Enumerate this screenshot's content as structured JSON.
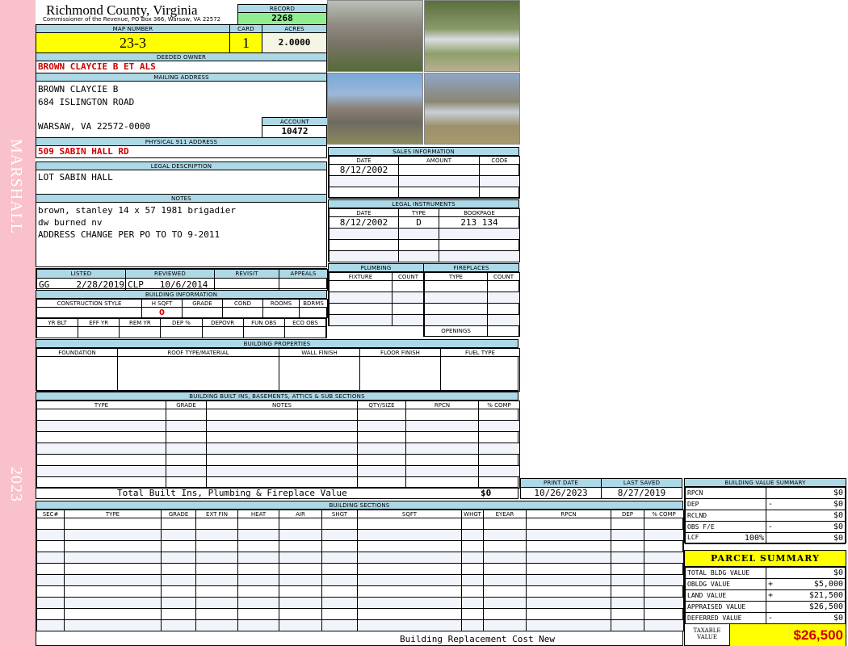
{
  "sidebar": {
    "district": "MARSHALL",
    "year": "2023"
  },
  "header": {
    "title": "Richmond County, Virginia",
    "subtitle": "Commissioner of the Revenue, PO Box 366, Warsaw, VA 22572",
    "record_label": "RECORD",
    "record": "2268"
  },
  "parcel": {
    "map_label": "MAP NUMBER",
    "map": "23-3",
    "card_label": "CARD",
    "card": "1",
    "acres_label": "ACRES",
    "acres": "2.0000"
  },
  "owner": {
    "label": "DEEDED OWNER",
    "name": "BROWN CLAYCIE B ET ALS"
  },
  "mailing": {
    "label": "MAILING ADDRESS",
    "line1": "BROWN CLAYCIE B",
    "line2": "684 ISLINGTON ROAD",
    "line3": "WARSAW, VA 22572-0000",
    "account_label": "ACCOUNT",
    "account": "10472"
  },
  "physical": {
    "label": "PHYSICAL 911 ADDRESS",
    "address": "509 SABIN HALL RD"
  },
  "legal": {
    "label": "LEGAL DESCRIPTION",
    "text": "LOT SABIN HALL"
  },
  "notes": {
    "label": "NOTES",
    "lines": [
      "brown, stanley 14 x 57 1981 brigadier",
      "dw burned nv",
      "ADDRESS CHANGE PER PO TO TO 9-2011"
    ]
  },
  "photos": [
    "house-front",
    "mobile-home",
    "house-side",
    "mobile-home-side"
  ],
  "sales": {
    "label": "SALES INFORMATION",
    "columns": [
      "DATE",
      "AMOUNT",
      "CODE"
    ],
    "rows": [
      [
        "8/12/2002",
        "",
        ""
      ],
      [
        "",
        "",
        ""
      ],
      [
        "",
        "",
        ""
      ]
    ]
  },
  "instruments": {
    "label": "LEGAL INSTRUMENTS",
    "columns": [
      "DATE",
      "TYPE",
      "BOOKPAGE"
    ],
    "rows": [
      [
        "8/12/2002",
        "D",
        "213 134"
      ],
      [
        "",
        "",
        ""
      ],
      [
        "",
        "",
        ""
      ],
      [
        "",
        "",
        ""
      ]
    ]
  },
  "review": {
    "columns": [
      "LISTED",
      "REVIEWED",
      "REVISIT",
      "APPEALS"
    ],
    "values": [
      "GG     2/28/2019",
      "CLP   10/6/2014",
      "",
      ""
    ]
  },
  "building_info": {
    "label": "BUILDING INFORMATION",
    "columns1": [
      "CONSTRUCTION STYLE",
      "H SQFT",
      "GRADE",
      "COND",
      "ROOMS",
      "BDRMS"
    ],
    "values1": [
      "",
      "0",
      "",
      "",
      "",
      ""
    ],
    "columns2": [
      "YR BLT",
      "EFF YR",
      "REM YR",
      "DEP %",
      "DEPOVR",
      "FUN OBS",
      "ECO OBS"
    ]
  },
  "plumbing": {
    "label": "PLUMBING",
    "columns": [
      "FIXTURE",
      "COUNT"
    ]
  },
  "fireplaces": {
    "label": "FIREPLACES",
    "columns": [
      "TYPE",
      "COUNT"
    ],
    "openings_label": "OPENINGS"
  },
  "properties": {
    "label": "BUILDING PROPERTIES",
    "columns": [
      "FOUNDATION",
      "ROOF TYPE/MATERIAL",
      "WALL FINISH",
      "FLOOR FINISH",
      "FUEL TYPE"
    ]
  },
  "builtins": {
    "label": "BUILDING BUILT INS, BASEMENTS, ATTICS & SUB SECTIONS",
    "columns": [
      "TYPE",
      "GRADE",
      "NOTES",
      "QTY/SIZE",
      "RPCN",
      "% COMP"
    ],
    "total_label": "Total Built Ins, Plumbing & Fireplace Value",
    "total": "$0"
  },
  "dates": {
    "print_label": "PRINT DATE",
    "print": "10/26/2023",
    "saved_label": "LAST SAVED",
    "saved": "8/27/2019"
  },
  "sections": {
    "label": "BUILDING SECTIONS",
    "columns": [
      "SEC#",
      "TYPE",
      "GRADE",
      "EXT FIN",
      "HEAT",
      "AIR",
      "SHGT",
      "SQFT",
      "WHGT",
      "EYEAR",
      "RPCN",
      "DEP",
      "% COMP"
    ],
    "footer": "Building Replacement Cost New"
  },
  "value_summary": {
    "label": "BUILDING VALUE SUMMARY",
    "rows": [
      {
        "label": "RPCN",
        "op": "",
        "value": "$0"
      },
      {
        "label": "DEP",
        "op": "-",
        "value": "$0"
      },
      {
        "label": "RCLND",
        "op": "",
        "value": "$0"
      },
      {
        "label": "OBS F/E",
        "op": "-",
        "value": "$0"
      },
      {
        "label": "LCF",
        "extra": "100%",
        "op": "",
        "value": "$0"
      }
    ]
  },
  "parcel_summary": {
    "label": "PARCEL SUMMARY",
    "rows": [
      {
        "label": "TOTAL BLDG VALUE",
        "op": "",
        "value": "$0"
      },
      {
        "label": "OBLDG VALUE",
        "op": "+",
        "value": "$5,000"
      },
      {
        "label": "LAND VALUE",
        "op": "+",
        "value": "$21,500"
      },
      {
        "label": "APPRAISED VALUE",
        "op": "",
        "value": "$26,500"
      },
      {
        "label": "DEFERRED VALUE",
        "op": "-",
        "value": "$0"
      }
    ],
    "taxable_label": "TAXABLE VALUE",
    "taxable": "$26,500"
  },
  "colors": {
    "header_blue": "#add8e6",
    "record_green": "#90ee90",
    "highlight_yellow": "#ffff00",
    "sidebar_pink": "#f8c1cb",
    "value_red": "#d00000"
  }
}
